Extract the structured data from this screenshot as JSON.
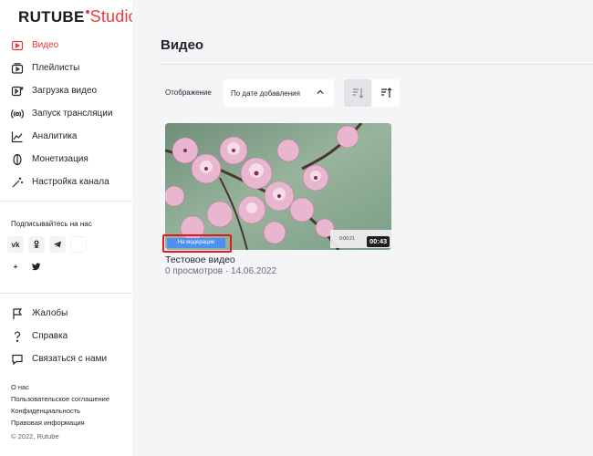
{
  "brand": {
    "name": "RUTUBE",
    "product": "Studio",
    "accent": "#ee3a3a"
  },
  "nav": {
    "items": [
      {
        "label": "Видео",
        "icon": "video-icon",
        "active": true
      },
      {
        "label": "Плейлисты",
        "icon": "playlist-icon"
      },
      {
        "label": "Загрузка видео",
        "icon": "upload-icon"
      },
      {
        "label": "Запуск трансляции",
        "icon": "broadcast-icon"
      },
      {
        "label": "Аналитика",
        "icon": "analytics-icon"
      },
      {
        "label": "Монетизация",
        "icon": "monetization-icon"
      },
      {
        "label": "Настройка канала",
        "icon": "magic-wand-icon"
      }
    ]
  },
  "subscribe": {
    "title": "Подписывайтесь на нас",
    "socials": [
      {
        "icon": "vk-icon",
        "text": "vk"
      },
      {
        "icon": "odnoklassniki-icon",
        "text": "ok"
      },
      {
        "icon": "telegram-icon",
        "text": ""
      },
      {
        "icon": "blank-icon",
        "text": ""
      },
      {
        "icon": "plus-icon",
        "text": "+"
      },
      {
        "icon": "twitter-icon",
        "text": ""
      }
    ]
  },
  "help": {
    "items": [
      {
        "label": "Жалобы",
        "icon": "flag-icon"
      },
      {
        "label": "Справка",
        "icon": "question-icon"
      },
      {
        "label": "Связаться с нами",
        "icon": "chat-icon"
      }
    ]
  },
  "footer": {
    "links": [
      "О нас",
      "Пользовательское соглашение",
      "Конфиденциальность",
      "Правовая информация"
    ],
    "copyright": "© 2022, Rutube"
  },
  "main": {
    "title": "Видео",
    "display_label": "Отображение",
    "sort_value": "По дате добавления"
  },
  "video": {
    "title": "Тестовое видео",
    "meta": "0 просмотров · 14.06.2022",
    "duration": "00:43",
    "player_time": "0:00:21",
    "status": "На модерации",
    "status_color": "#4f8ff2"
  }
}
